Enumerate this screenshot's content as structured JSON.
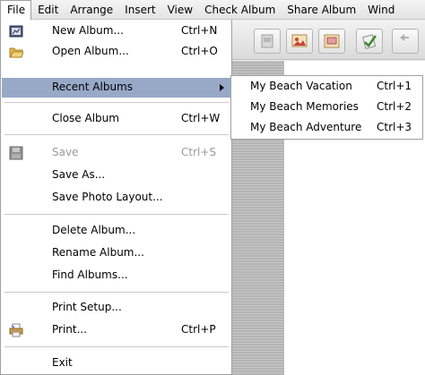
{
  "menubar": {
    "items": [
      {
        "label": "File"
      },
      {
        "label": "Edit"
      },
      {
        "label": "Arrange"
      },
      {
        "label": "Insert"
      },
      {
        "label": "View"
      },
      {
        "label": "Check Album"
      },
      {
        "label": "Share Album"
      },
      {
        "label": "Wind"
      }
    ]
  },
  "file_menu": {
    "new_album": {
      "label": "New Album...",
      "shortcut": "Ctrl+N",
      "icon": "new-album-icon"
    },
    "open_album": {
      "label": "Open Album...",
      "shortcut": "Ctrl+O",
      "icon": "folder-icon"
    },
    "recent_albums": {
      "label": "Recent Albums"
    },
    "close_album": {
      "label": "Close Album",
      "shortcut": "Ctrl+W"
    },
    "save": {
      "label": "Save",
      "shortcut": "Ctrl+S",
      "icon": "save-icon",
      "disabled": true
    },
    "save_as": {
      "label": "Save As..."
    },
    "save_photo_layout": {
      "label": "Save Photo Layout..."
    },
    "delete_album": {
      "label": "Delete Album..."
    },
    "rename_album": {
      "label": "Rename Album..."
    },
    "find_albums": {
      "label": "Find Albums..."
    },
    "print_setup": {
      "label": "Print Setup..."
    },
    "print": {
      "label": "Print...",
      "shortcut": "Ctrl+P",
      "icon": "printer-icon"
    },
    "exit": {
      "label": "Exit"
    }
  },
  "recent_albums_menu": {
    "items": [
      {
        "label": "My Beach Vacation",
        "shortcut": "Ctrl+1"
      },
      {
        "label": "My Beach Memories",
        "shortcut": "Ctrl+2"
      },
      {
        "label": "My Beach Adventure",
        "shortcut": "Ctrl+3"
      }
    ]
  },
  "colors": {
    "highlight": "#98a9c8",
    "disabled_text": "#9a9a9a",
    "menu_border": "#a0a0a0"
  }
}
